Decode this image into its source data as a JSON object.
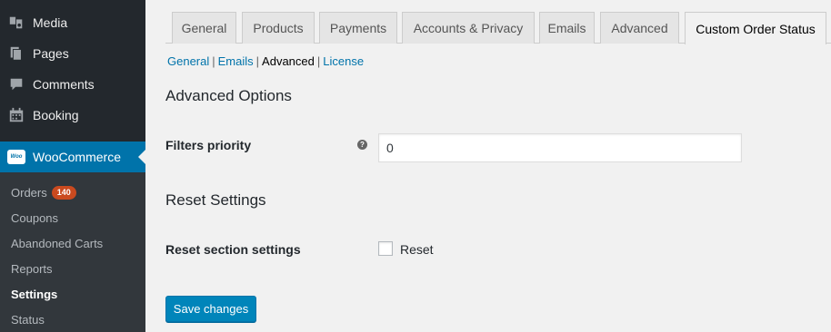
{
  "sidebar": {
    "items": [
      {
        "label": "Media",
        "icon": "media-icon"
      },
      {
        "label": "Pages",
        "icon": "pages-icon"
      },
      {
        "label": "Comments",
        "icon": "comments-icon"
      },
      {
        "label": "Booking",
        "icon": "calendar-icon"
      }
    ],
    "woocommerce": {
      "label": "WooCommerce",
      "icon_text": "Woo"
    },
    "submenu": [
      {
        "label": "Orders",
        "badge": "140"
      },
      {
        "label": "Coupons"
      },
      {
        "label": "Abandoned Carts"
      },
      {
        "label": "Reports"
      },
      {
        "label": "Settings"
      },
      {
        "label": "Status"
      }
    ]
  },
  "tabs": [
    "General",
    "Products",
    "Payments",
    "Accounts & Privacy",
    "Emails",
    "Advanced",
    "Custom Order Status"
  ],
  "subnav": {
    "links": [
      "General",
      "Emails",
      "Advanced",
      "License"
    ],
    "separator": "|"
  },
  "advanced": {
    "heading": "Advanced Options",
    "filters_label": "Filters priority",
    "help": "?",
    "filters_value": "0"
  },
  "reset": {
    "heading": "Reset Settings",
    "label": "Reset section settings",
    "checkbox_label": "Reset"
  },
  "save_button": "Save changes",
  "colors": {
    "sidebar_bg": "#23282d",
    "active_menu": "#0073aa",
    "button": "#0085ba",
    "link": "#0073aa",
    "badge": "#ca4a1f"
  }
}
